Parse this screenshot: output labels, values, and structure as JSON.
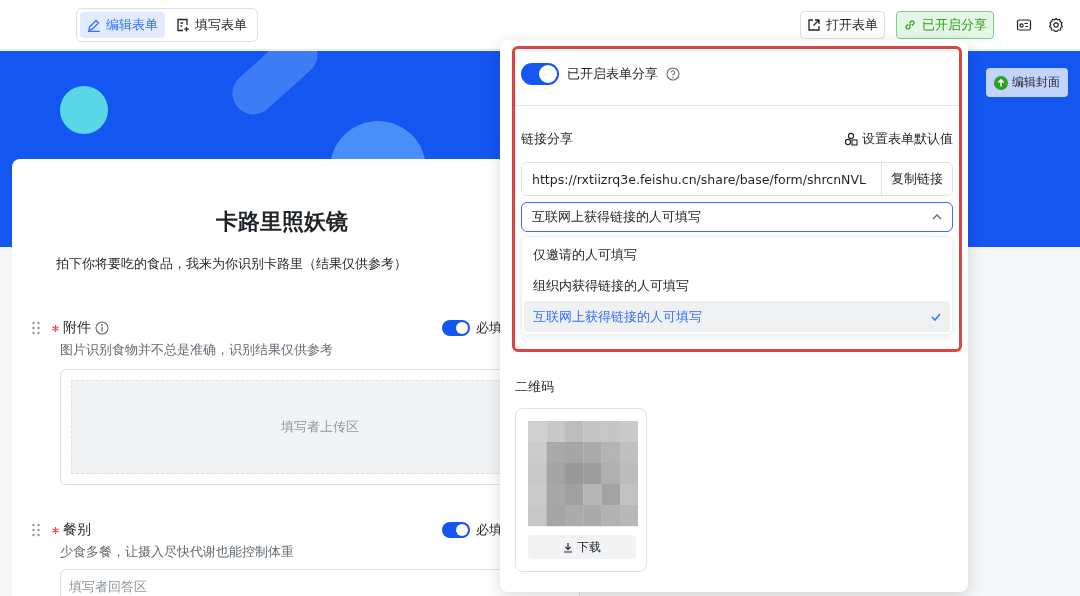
{
  "toolbar": {
    "mode_tabs": [
      {
        "label": "编辑表单",
        "kind": "edit",
        "selected": true
      },
      {
        "label": "填写表单",
        "kind": "fill",
        "selected": false
      }
    ],
    "buttons": [
      {
        "label": "打开表单",
        "kind": "open"
      },
      {
        "label": "已开启分享",
        "kind": "shared"
      }
    ]
  },
  "cover": {
    "button": "编辑封面"
  },
  "form": {
    "title": "卡路里照妖镜",
    "description": "拍下你将要吃的食品，我来为你识别卡路里（结果仅供参考）",
    "fields": [
      {
        "label": "附件",
        "required": true,
        "info": true,
        "hint": "图片识别食物并不总是准确，识别结果仅供参考",
        "toggle": {
          "label": "必填",
          "on": true
        },
        "kind": "upload",
        "area_text": "填写者上传区"
      },
      {
        "label": "餐别",
        "required": true,
        "info": false,
        "hint": "少食多餐，让摄入尽快代谢也能控制体重",
        "toggle": {
          "label": "必填",
          "on": true
        },
        "kind": "text",
        "placeholder": "填写者回答区"
      }
    ]
  },
  "share_panel": {
    "toggle": {
      "label": "已开启表单分享",
      "on": true
    },
    "link_title": "链接分享",
    "default_button": "设置表单默认值",
    "url": "https://rxtiizrq3e.feishu.cn/share/base/form/shrcnNVL",
    "copy_button": "复制链接",
    "permission": {
      "value": "互联网上获得链接的人可填写",
      "expanded": true,
      "options": [
        {
          "label": "仅邀请的人可填写",
          "selected": false
        },
        {
          "label": "组织内获得链接的人可填写",
          "selected": false
        },
        {
          "label": "互联网上获得链接的人可填写",
          "selected": true
        }
      ]
    },
    "qr_title": "二维码",
    "download_button": "下载"
  }
}
